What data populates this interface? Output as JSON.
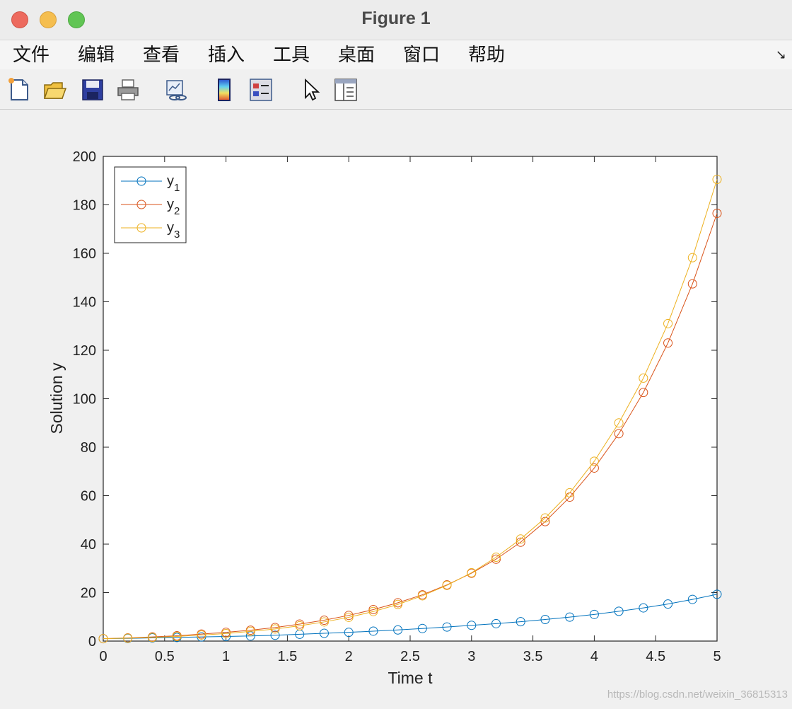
{
  "window": {
    "title": "Figure 1"
  },
  "menu": {
    "items": [
      "文件",
      "编辑",
      "查看",
      "插入",
      "工具",
      "桌面",
      "窗口",
      "帮助"
    ],
    "corner_glyph": "↘"
  },
  "toolbar": {
    "tools": [
      "new-figure-icon",
      "open-file-icon",
      "save-icon",
      "print-icon",
      "link-plot-icon",
      "colorbar-icon",
      "legend-icon",
      "pointer-icon",
      "property-inspector-icon"
    ]
  },
  "watermark": "https://blog.csdn.net/weixin_36815313",
  "chart_data": {
    "type": "line",
    "xlabel": "Time t",
    "ylabel": "Solution y",
    "xlim": [
      0,
      5
    ],
    "ylim": [
      0,
      200
    ],
    "xticks": [
      0,
      0.5,
      1,
      1.5,
      2,
      2.5,
      3,
      3.5,
      4,
      4.5,
      5
    ],
    "xtick_labels": [
      "0",
      "0.5",
      "1",
      "1.5",
      "2",
      "2.5",
      "3",
      "3.5",
      "4",
      "4.5",
      "5"
    ],
    "yticks": [
      0,
      20,
      40,
      60,
      80,
      100,
      120,
      140,
      160,
      180,
      200
    ],
    "ytick_labels": [
      "0",
      "20",
      "40",
      "60",
      "80",
      "100",
      "120",
      "140",
      "160",
      "180",
      "200"
    ],
    "grid": false,
    "legend_position": "top-left",
    "marker": "circle",
    "x": [
      0,
      0.2,
      0.4,
      0.6,
      0.8,
      1.0,
      1.2,
      1.4,
      1.6,
      1.8,
      2.0,
      2.2,
      2.4,
      2.6,
      2.8,
      3.0,
      3.2,
      3.4,
      3.6,
      3.8,
      4.0,
      4.2,
      4.4,
      4.6,
      4.8,
      5.0
    ],
    "series": [
      {
        "name": "y",
        "subscript": "1",
        "color": "#0072bd",
        "values": [
          1.0,
          1.1,
          1.3,
          1.5,
          1.7,
          1.9,
          2.1,
          2.4,
          2.8,
          3.2,
          3.6,
          4.1,
          4.6,
          5.2,
          5.8,
          6.5,
          7.2,
          8.0,
          8.9,
          9.9,
          11.0,
          12.3,
          13.7,
          15.3,
          17.2,
          19.3
        ]
      },
      {
        "name": "y",
        "subscript": "2",
        "color": "#d95319",
        "values": [
          1.0,
          1.3,
          1.7,
          2.2,
          2.9,
          3.6,
          4.5,
          5.6,
          7.0,
          8.6,
          10.6,
          13.0,
          15.8,
          19.1,
          23.2,
          28.0,
          33.8,
          40.8,
          49.3,
          59.4,
          71.4,
          85.6,
          102.6,
          123.0,
          147.4,
          176.5
        ]
      },
      {
        "name": "y",
        "subscript": "3",
        "color": "#edb120",
        "values": [
          1.0,
          1.2,
          1.5,
          1.9,
          2.5,
          3.1,
          4.0,
          5.0,
          6.3,
          7.9,
          9.8,
          12.2,
          15.1,
          18.7,
          23.0,
          28.2,
          34.6,
          42.1,
          50.8,
          61.2,
          74.2,
          90.0,
          108.5,
          131.0,
          158.2,
          190.5
        ]
      }
    ]
  }
}
